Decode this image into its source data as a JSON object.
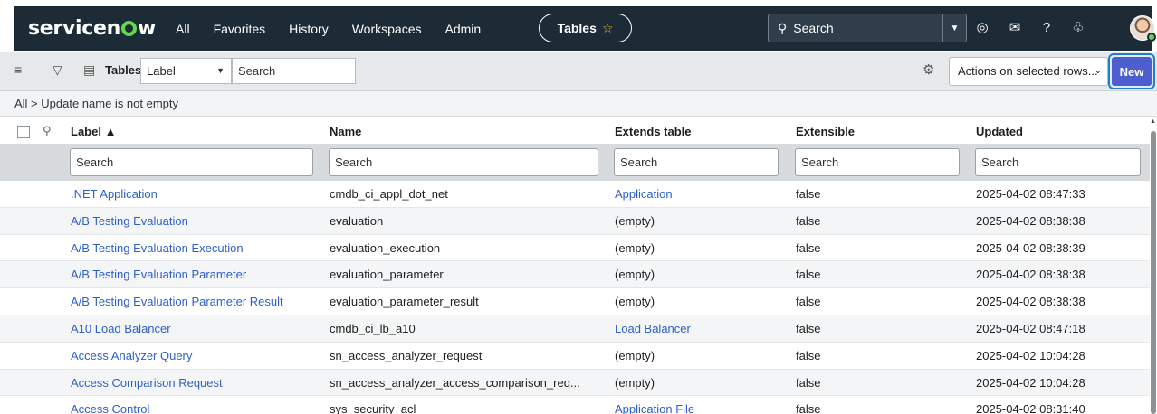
{
  "nav": {
    "brand_left": "servicen",
    "brand_right": "w",
    "links": [
      "All",
      "Favorites",
      "History",
      "Workspaces",
      "Admin"
    ],
    "context": "Tables",
    "search_placeholder": "Search"
  },
  "listbar": {
    "title": "Tables",
    "field_select": "Label",
    "search_placeholder": "Search",
    "actions_select": "Actions on selected rows...",
    "new_label": "New"
  },
  "breadcrumb": "All > Update name is not empty",
  "table": {
    "columns": [
      "Label ▲",
      "Name",
      "Extends table",
      "Extensible",
      "Updated"
    ],
    "filter_placeholder": "Search",
    "rows": [
      {
        "label": ".NET Application",
        "name": "cmdb_ci_appl_dot_net",
        "extends": "Application",
        "extends_link": true,
        "extensible": "false",
        "updated": "2025-04-02 08:47:33"
      },
      {
        "label": "A/B Testing Evaluation",
        "name": "evaluation",
        "extends": "(empty)",
        "extends_link": false,
        "extensible": "false",
        "updated": "2025-04-02 08:38:38"
      },
      {
        "label": "A/B Testing Evaluation Execution",
        "name": "evaluation_execution",
        "extends": "(empty)",
        "extends_link": false,
        "extensible": "false",
        "updated": "2025-04-02 08:38:39"
      },
      {
        "label": "A/B Testing Evaluation Parameter",
        "name": "evaluation_parameter",
        "extends": "(empty)",
        "extends_link": false,
        "extensible": "false",
        "updated": "2025-04-02 08:38:38"
      },
      {
        "label": "A/B Testing Evaluation Parameter Result",
        "name": "evaluation_parameter_result",
        "extends": "(empty)",
        "extends_link": false,
        "extensible": "false",
        "updated": "2025-04-02 08:38:38"
      },
      {
        "label": "A10 Load Balancer",
        "name": "cmdb_ci_lb_a10",
        "extends": "Load Balancer",
        "extends_link": true,
        "extensible": "false",
        "updated": "2025-04-02 08:47:18"
      },
      {
        "label": "Access Analyzer Query",
        "name": "sn_access_analyzer_request",
        "extends": "(empty)",
        "extends_link": false,
        "extensible": "false",
        "updated": "2025-04-02 10:04:28"
      },
      {
        "label": "Access Comparison Request",
        "name": "sn_access_analyzer_access_comparison_req...",
        "extends": "(empty)",
        "extends_link": false,
        "extensible": "false",
        "updated": "2025-04-02 10:04:28"
      },
      {
        "label": "Access Control",
        "name": "sys_security_acl",
        "extends": "Application File",
        "extends_link": true,
        "extensible": "false",
        "updated": "2025-04-02 08:31:40"
      }
    ]
  },
  "colors": {
    "nav_bg": "#1c2b36",
    "link": "#2e60c8",
    "new_button": "#4e5ecf",
    "brand_accent": "#62d84e"
  }
}
